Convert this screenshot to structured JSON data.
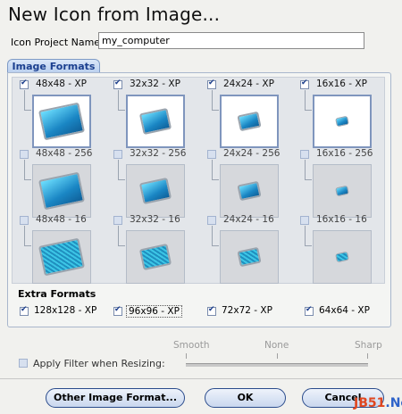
{
  "window": {
    "title": "New Icon from Image..."
  },
  "project": {
    "label": "Icon Project Name:",
    "value": "my_computer"
  },
  "tab": {
    "label": "Image Formats"
  },
  "formats": [
    [
      {
        "label": "48x48 - XP",
        "checked": true
      },
      {
        "label": "32x32 - XP",
        "checked": true
      },
      {
        "label": "24x24 - XP",
        "checked": true
      },
      {
        "label": "16x16 - XP",
        "checked": true
      }
    ],
    [
      {
        "label": "48x48 - 256",
        "checked": false
      },
      {
        "label": "32x32 - 256",
        "checked": false
      },
      {
        "label": "24x24 - 256",
        "checked": false
      },
      {
        "label": "16x16 - 256",
        "checked": false
      }
    ],
    [
      {
        "label": "48x48 - 16",
        "checked": false
      },
      {
        "label": "32x32 - 16",
        "checked": false
      },
      {
        "label": "24x24 - 16",
        "checked": false
      },
      {
        "label": "16x16 - 16",
        "checked": false
      }
    ]
  ],
  "extra": {
    "title": "Extra Formats",
    "items": [
      {
        "label": "128x128 - XP",
        "checked": true
      },
      {
        "label": "96x96 - XP",
        "checked": true
      },
      {
        "label": "72x72 - XP",
        "checked": true
      },
      {
        "label": "64x64 - XP",
        "checked": true
      }
    ]
  },
  "filter": {
    "label": "Apply Filter when Resizing:",
    "checked": false,
    "slider_labels": [
      "Smooth",
      "None",
      "Sharp"
    ]
  },
  "buttons": {
    "other": "Other Image Format...",
    "ok": "OK",
    "cancel": "Cancel"
  },
  "watermark": {
    "part1": "JB51",
    "part2": ".Net"
  }
}
